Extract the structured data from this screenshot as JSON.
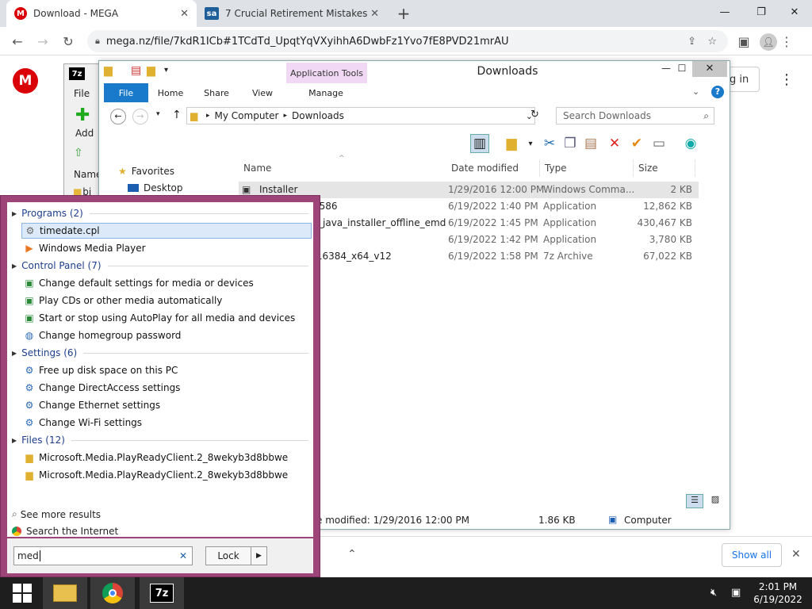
{
  "browser": {
    "tabs": [
      {
        "title": "Download - MEGA",
        "favicon": "M",
        "color": "#d90007"
      },
      {
        "title": "7 Crucial Retirement Mistakes",
        "favicon": "sa",
        "color": "#1f5f99"
      }
    ],
    "url": "mega.nz/file/7kdR1ICb#1TCdTd_UpqtYqVXyihhA6DwbFz1Yvo7fE8PVD21mrAU"
  },
  "mega": {
    "logo": "M",
    "login_partial": "g in"
  },
  "sevenzip": {
    "logo": "7z",
    "menu_file": "File",
    "add_label": "Add",
    "name_col": "Name",
    "bin_label": "bi"
  },
  "explorer": {
    "title": "Downloads",
    "app_tools": "Application Tools",
    "ribbon_tabs": [
      "File",
      "Home",
      "Share",
      "View",
      "Manage"
    ],
    "address": {
      "root": "My Computer",
      "folder": "Downloads"
    },
    "search_placeholder": "Search Downloads",
    "nav": {
      "favorites": "Favorites",
      "desktop": "Desktop"
    },
    "columns": {
      "name": "Name",
      "date": "Date modified",
      "type": "Type",
      "size": "Size"
    },
    "files": [
      {
        "name": "Installer",
        "date": "1/29/2016 12:00 PM",
        "type": "Windows Comma...",
        "size": "2 KB"
      },
      {
        "name": "-i586",
        "date": "6/19/2022 1:40 PM",
        "type": "Application",
        "size": "12,862 KB"
      },
      {
        "name": "_java_installer_offline_emd",
        "date": "6/19/2022 1:45 PM",
        "type": "Application",
        "size": "430,467 KB"
      },
      {
        "name": "",
        "date": "6/19/2022 1:42 PM",
        "type": "Application",
        "size": "3,780 KB"
      },
      {
        "name": ".16384_x64_v12",
        "date": "6/19/2022 1:58 PM",
        "type": "7z Archive",
        "size": "67,022 KB"
      }
    ],
    "status": {
      "modified": "e modified: 1/29/2016 12:00 PM",
      "size": "1.86 KB",
      "location": "Computer"
    }
  },
  "startmenu": {
    "groups": [
      {
        "label": "Programs (2)",
        "items": [
          "timedate.cpl",
          "Windows Media Player"
        ]
      },
      {
        "label": "Control Panel (7)",
        "items": [
          "Change default settings for media or devices",
          "Play CDs or other media automatically",
          "Start or stop using AutoPlay for all media and devices",
          "Change homegroup password"
        ]
      },
      {
        "label": "Settings (6)",
        "items": [
          "Free up disk space on this PC",
          "Change DirectAccess settings",
          "Change Ethernet settings",
          "Change Wi-Fi settings"
        ]
      },
      {
        "label": "Files (12)",
        "items": [
          "Microsoft.Media.PlayReadyClient.2_8wekyb3d8bbwe",
          "Microsoft.Media.PlayReadyClient.2_8wekyb3d8bbwe"
        ]
      }
    ],
    "see_more": "See more results",
    "search_internet": "Search the Internet",
    "search_value": "med",
    "lock_label": "Lock"
  },
  "downloadbar": {
    "show_all": "Show all"
  },
  "taskbar": {
    "time": "2:01 PM",
    "date": "6/19/2022",
    "sevenzip_label": "7z"
  }
}
